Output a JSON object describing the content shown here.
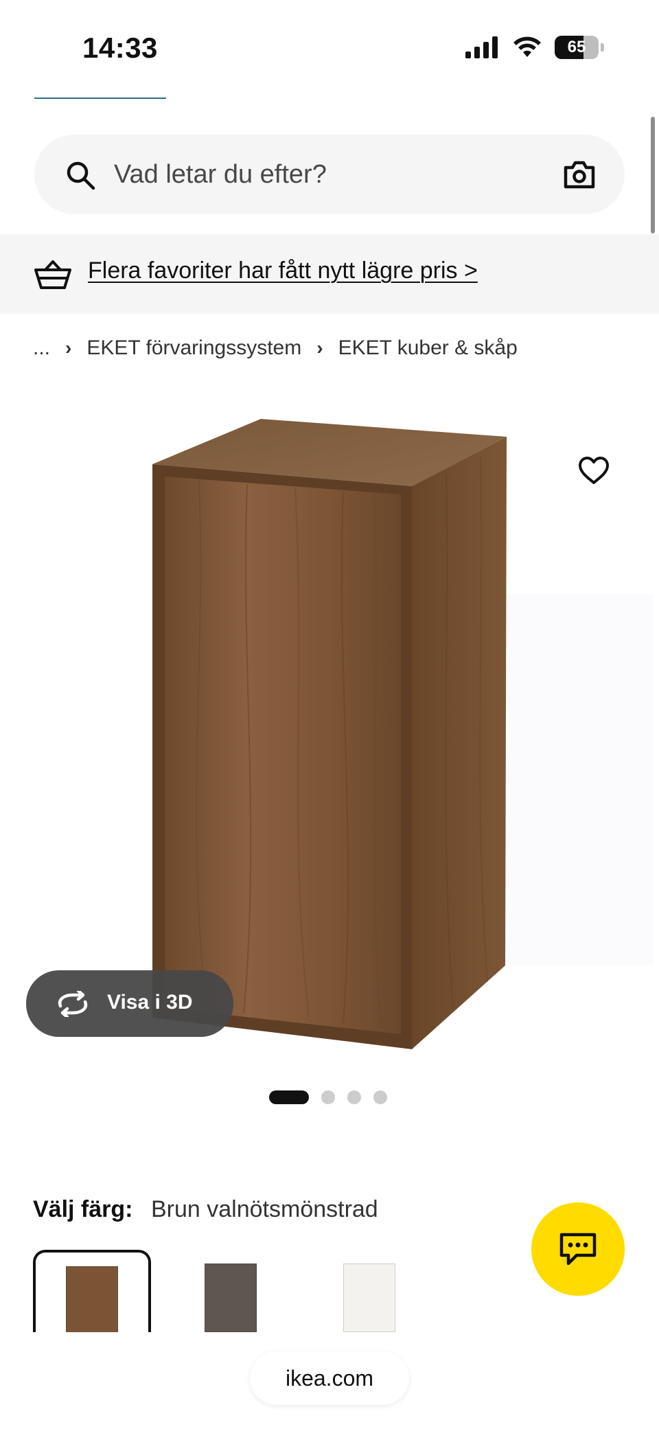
{
  "status_bar": {
    "time": "14:33",
    "battery": "65",
    "battery_level": 0.65,
    "icons": [
      "signal-icon",
      "wifi-icon",
      "battery-icon"
    ]
  },
  "search": {
    "placeholder": "Vad letar du efter?",
    "icons": [
      "search-icon",
      "camera-icon"
    ]
  },
  "promo": {
    "text": "Flera favoriter har fått nytt lägre pris >",
    "icon": "basket-icon"
  },
  "breadcrumb": {
    "items": [
      "...",
      "EKET förvaringssystem",
      "EKET kuber & skåp"
    ],
    "separator": "›"
  },
  "product": {
    "favorite_icon": "heart-icon",
    "view_3d_label": "Visa i 3D",
    "carousel": {
      "total": 4,
      "active": 0
    }
  },
  "color_selector": {
    "label": "Välj färg:",
    "value": "Brun valnötsmönstrad",
    "swatches": [
      {
        "name": "Brun valnötsmönstrad",
        "color": "#7a5434",
        "selected": true
      },
      {
        "name": "Mörkgrå",
        "color": "#5f5651",
        "selected": false
      },
      {
        "name": "Vit",
        "color": "#f4f2ee",
        "selected": false
      }
    ]
  },
  "chat": {
    "icon": "chat-icon",
    "color": "#ffdb00"
  },
  "browser": {
    "url": "ikea.com"
  },
  "colors": {
    "accent": "#2e6f84",
    "wood": "#7a5434",
    "chat": "#ffdb00"
  }
}
